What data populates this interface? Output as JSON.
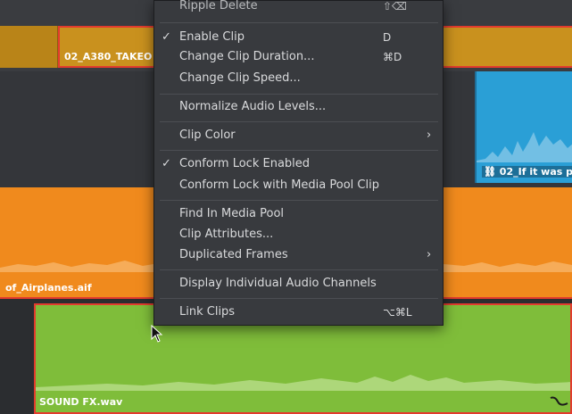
{
  "timeline": {
    "clips": {
      "video_top": {
        "label": "02_A380_TAKEO"
      },
      "blue_clip": {
        "label": "02_If it was p"
      },
      "orange_clip": {
        "label": "of_Airplanes.aif"
      },
      "green_clip": {
        "label": "SOUND FX.wav"
      }
    },
    "colors": {
      "background": "#2b2d30",
      "gold": "#c9911e",
      "orange": "#f08a1d",
      "green": "#7fbd3a",
      "blue": "#2a9fd6",
      "selection_outline": "#e23b2e"
    }
  },
  "context_menu": {
    "items": [
      {
        "label": "Ripple Delete",
        "shortcut": "⇧⌫",
        "checked": ""
      },
      {
        "label": "Enable Clip",
        "shortcut": "D",
        "checked": "✓"
      },
      {
        "label": "Change Clip Duration...",
        "shortcut": "⌘D",
        "checked": ""
      },
      {
        "label": "Change Clip Speed...",
        "shortcut": "",
        "checked": ""
      },
      {
        "label": "Normalize Audio Levels...",
        "shortcut": "",
        "checked": ""
      },
      {
        "label": "Clip Color",
        "shortcut": "",
        "submenu": "›",
        "checked": ""
      },
      {
        "label": "Conform Lock Enabled",
        "shortcut": "",
        "checked": "✓"
      },
      {
        "label": "Conform Lock with Media Pool Clip",
        "shortcut": "",
        "checked": ""
      },
      {
        "label": "Find In Media Pool",
        "shortcut": "",
        "checked": ""
      },
      {
        "label": "Clip Attributes...",
        "shortcut": "",
        "checked": ""
      },
      {
        "label": "Duplicated Frames",
        "shortcut": "",
        "submenu": "›",
        "checked": ""
      },
      {
        "label": "Display Individual Audio Channels",
        "shortcut": "",
        "checked": ""
      },
      {
        "label": "Link Clips",
        "shortcut": "⌥⌘L",
        "checked": ""
      }
    ]
  }
}
